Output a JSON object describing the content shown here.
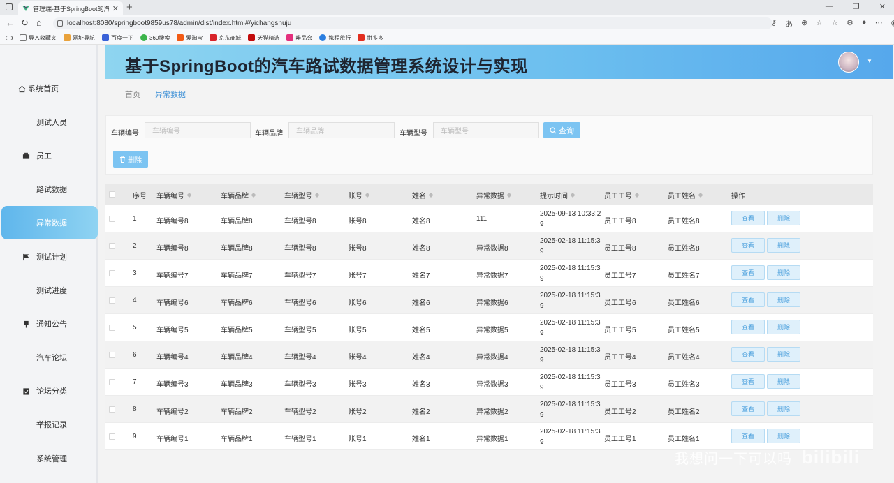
{
  "browser": {
    "tab_title": "管理端-基于SpringBoot的汽车路试",
    "url": "localhost:8080/springboot9859us78/admin/dist/index.html#/yichangshuju",
    "bookmarks": [
      "导入收藏夹",
      "网址导航",
      "百度一下",
      "360搜索",
      "爱淘宝",
      "京东商城",
      "天猫精选",
      "唯品会",
      "携程旅行",
      "拼多多"
    ]
  },
  "header": {
    "title": "基于SpringBoot的汽车路试数据管理系统设计与实现"
  },
  "sidebar": {
    "items": [
      {
        "label": "系统首页"
      },
      {
        "label": "测试人员"
      },
      {
        "label": "员工"
      },
      {
        "label": "路试数据"
      },
      {
        "label": "异常数据"
      },
      {
        "label": "测试计划"
      },
      {
        "label": "测试进度"
      },
      {
        "label": "通知公告"
      },
      {
        "label": "汽车论坛"
      },
      {
        "label": "论坛分类"
      },
      {
        "label": "举报记录"
      },
      {
        "label": "系统管理"
      }
    ],
    "active": "异常数据"
  },
  "breadcrumb": {
    "home": "首页",
    "current": "异常数据"
  },
  "search": {
    "fields": [
      {
        "label": "车辆编号",
        "placeholder": "车辆编号"
      },
      {
        "label": "车辆品牌",
        "placeholder": "车辆品牌"
      },
      {
        "label": "车辆型号",
        "placeholder": "车辆型号"
      }
    ],
    "query_label": "查询",
    "delete_label": "删除"
  },
  "table": {
    "columns": [
      "序号",
      "车辆编号",
      "车辆品牌",
      "车辆型号",
      "账号",
      "姓名",
      "异常数据",
      "提示时间",
      "员工工号",
      "员工姓名",
      "操作"
    ],
    "view_label": "查看",
    "delete_label": "删除",
    "rows": [
      {
        "no": "1",
        "car_no": "车辆编号8",
        "brand": "车辆品牌8",
        "model": "车辆型号8",
        "account": "账号8",
        "name": "姓名8",
        "abnormal": "111",
        "time": "2025-09-13 10:33:29",
        "emp_no": "员工工号8",
        "emp_name": "员工姓名8"
      },
      {
        "no": "2",
        "car_no": "车辆编号8",
        "brand": "车辆品牌8",
        "model": "车辆型号8",
        "account": "账号8",
        "name": "姓名8",
        "abnormal": "异常数据8",
        "time": "2025-02-18 11:15:39",
        "emp_no": "员工工号8",
        "emp_name": "员工姓名8"
      },
      {
        "no": "3",
        "car_no": "车辆编号7",
        "brand": "车辆品牌7",
        "model": "车辆型号7",
        "account": "账号7",
        "name": "姓名7",
        "abnormal": "异常数据7",
        "time": "2025-02-18 11:15:39",
        "emp_no": "员工工号7",
        "emp_name": "员工姓名7"
      },
      {
        "no": "4",
        "car_no": "车辆编号6",
        "brand": "车辆品牌6",
        "model": "车辆型号6",
        "account": "账号6",
        "name": "姓名6",
        "abnormal": "异常数据6",
        "time": "2025-02-18 11:15:39",
        "emp_no": "员工工号6",
        "emp_name": "员工姓名6"
      },
      {
        "no": "5",
        "car_no": "车辆编号5",
        "brand": "车辆品牌5",
        "model": "车辆型号5",
        "account": "账号5",
        "name": "姓名5",
        "abnormal": "异常数据5",
        "time": "2025-02-18 11:15:39",
        "emp_no": "员工工号5",
        "emp_name": "员工姓名5"
      },
      {
        "no": "6",
        "car_no": "车辆编号4",
        "brand": "车辆品牌4",
        "model": "车辆型号4",
        "account": "账号4",
        "name": "姓名4",
        "abnormal": "异常数据4",
        "time": "2025-02-18 11:15:39",
        "emp_no": "员工工号4",
        "emp_name": "员工姓名4"
      },
      {
        "no": "7",
        "car_no": "车辆编号3",
        "brand": "车辆品牌3",
        "model": "车辆型号3",
        "account": "账号3",
        "name": "姓名3",
        "abnormal": "异常数据3",
        "time": "2025-02-18 11:15:39",
        "emp_no": "员工工号3",
        "emp_name": "员工姓名3"
      },
      {
        "no": "8",
        "car_no": "车辆编号2",
        "brand": "车辆品牌2",
        "model": "车辆型号2",
        "account": "账号2",
        "name": "姓名2",
        "abnormal": "异常数据2",
        "time": "2025-02-18 11:15:39",
        "emp_no": "员工工号2",
        "emp_name": "员工姓名2"
      },
      {
        "no": "9",
        "car_no": "车辆编号1",
        "brand": "车辆品牌1",
        "model": "车辆型号1",
        "account": "账号1",
        "name": "姓名1",
        "abnormal": "异常数据1",
        "time": "2025-02-18 11:15:39",
        "emp_no": "员工工号1",
        "emp_name": "员工姓名1"
      }
    ]
  },
  "watermark": {
    "text": "我想问一下可以吗",
    "logo": "bilibili"
  },
  "colors": {
    "accent": "#5fb6ec",
    "header_start": "#8ed5f0",
    "header_end": "#56a8ec",
    "button": "#7cc4f2"
  }
}
